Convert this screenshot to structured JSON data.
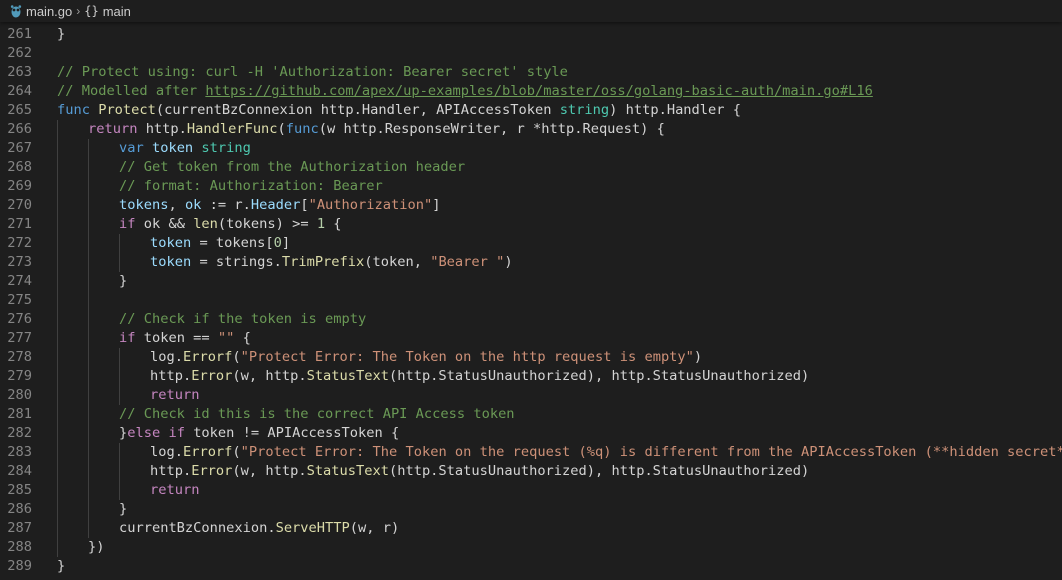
{
  "breadcrumb": {
    "file": "main.go",
    "separator": "›",
    "symbol_icon": "{}",
    "symbol": "main"
  },
  "colors": {
    "background": "#1e1e1e",
    "keyword": "#569cd6",
    "control": "#c586c0",
    "function": "#dcdcaa",
    "variable": "#9cdcfe",
    "string": "#ce9178",
    "comment": "#6a9955",
    "number": "#b5cea8",
    "line_number": "#858585"
  },
  "icons": {
    "file": "go-gopher-icon",
    "symbol": "braces-icon"
  },
  "editor": {
    "lines": [
      {
        "n": "261",
        "indent": 0,
        "tokens": [
          {
            "t": "}",
            "c": "plain"
          }
        ]
      },
      {
        "n": "262",
        "indent": 0,
        "tokens": []
      },
      {
        "n": "263",
        "indent": 0,
        "tokens": [
          {
            "t": "// Protect using: curl -H 'Authorization: Bearer secret' style",
            "c": "com"
          }
        ]
      },
      {
        "n": "264",
        "indent": 0,
        "tokens": [
          {
            "t": "// Modelled after ",
            "c": "com"
          },
          {
            "t": "https://github.com/apex/up-examples/blob/master/oss/golang-basic-auth/main.go#L16",
            "c": "link"
          }
        ]
      },
      {
        "n": "265",
        "indent": 0,
        "tokens": [
          {
            "t": "func ",
            "c": "kw"
          },
          {
            "t": "Protect",
            "c": "fn"
          },
          {
            "t": "(currentBzConnexion http.Handler, APIAccessToken ",
            "c": "plain"
          },
          {
            "t": "string",
            "c": "typ"
          },
          {
            "t": ") http.Handler {",
            "c": "plain"
          }
        ]
      },
      {
        "n": "266",
        "indent": 1,
        "tokens": [
          {
            "t": "return ",
            "c": "ctl"
          },
          {
            "t": "http.",
            "c": "plain"
          },
          {
            "t": "HandlerFunc",
            "c": "fn"
          },
          {
            "t": "(",
            "c": "plain"
          },
          {
            "t": "func",
            "c": "kw"
          },
          {
            "t": "(w http.ResponseWriter, r *http.Request) {",
            "c": "plain"
          }
        ]
      },
      {
        "n": "267",
        "indent": 2,
        "tokens": [
          {
            "t": "var ",
            "c": "kw"
          },
          {
            "t": "token ",
            "c": "var"
          },
          {
            "t": "string",
            "c": "typ"
          }
        ]
      },
      {
        "n": "268",
        "indent": 2,
        "tokens": [
          {
            "t": "// Get token from the Authorization header",
            "c": "com"
          }
        ]
      },
      {
        "n": "269",
        "indent": 2,
        "tokens": [
          {
            "t": "// format: Authorization: Bearer",
            "c": "com"
          }
        ]
      },
      {
        "n": "270",
        "indent": 2,
        "tokens": [
          {
            "t": "tokens",
            "c": "var"
          },
          {
            "t": ", ",
            "c": "plain"
          },
          {
            "t": "ok",
            "c": "var"
          },
          {
            "t": " := r.",
            "c": "plain"
          },
          {
            "t": "Header",
            "c": "var"
          },
          {
            "t": "[",
            "c": "plain"
          },
          {
            "t": "\"Authorization\"",
            "c": "str"
          },
          {
            "t": "]",
            "c": "plain"
          }
        ]
      },
      {
        "n": "271",
        "indent": 2,
        "tokens": [
          {
            "t": "if ",
            "c": "ctl"
          },
          {
            "t": "ok && ",
            "c": "plain"
          },
          {
            "t": "len",
            "c": "fn"
          },
          {
            "t": "(tokens) >= ",
            "c": "plain"
          },
          {
            "t": "1",
            "c": "num"
          },
          {
            "t": " {",
            "c": "plain"
          }
        ]
      },
      {
        "n": "272",
        "indent": 3,
        "tokens": [
          {
            "t": "token",
            "c": "var"
          },
          {
            "t": " = tokens[",
            "c": "plain"
          },
          {
            "t": "0",
            "c": "num"
          },
          {
            "t": "]",
            "c": "plain"
          }
        ]
      },
      {
        "n": "273",
        "indent": 3,
        "tokens": [
          {
            "t": "token",
            "c": "var"
          },
          {
            "t": " = strings.",
            "c": "plain"
          },
          {
            "t": "TrimPrefix",
            "c": "fn"
          },
          {
            "t": "(token, ",
            "c": "plain"
          },
          {
            "t": "\"Bearer \"",
            "c": "str"
          },
          {
            "t": ")",
            "c": "plain"
          }
        ]
      },
      {
        "n": "274",
        "indent": 2,
        "tokens": [
          {
            "t": "}",
            "c": "plain"
          }
        ]
      },
      {
        "n": "275",
        "indent": 2,
        "tokens": []
      },
      {
        "n": "276",
        "indent": 2,
        "tokens": [
          {
            "t": "// Check if the token is empty",
            "c": "com"
          }
        ]
      },
      {
        "n": "277",
        "indent": 2,
        "tokens": [
          {
            "t": "if ",
            "c": "ctl"
          },
          {
            "t": "token == ",
            "c": "plain"
          },
          {
            "t": "\"\"",
            "c": "str"
          },
          {
            "t": " {",
            "c": "plain"
          }
        ]
      },
      {
        "n": "278",
        "indent": 3,
        "tokens": [
          {
            "t": "log.",
            "c": "plain"
          },
          {
            "t": "Errorf",
            "c": "fn"
          },
          {
            "t": "(",
            "c": "plain"
          },
          {
            "t": "\"Protect Error: The Token on the http request is empty\"",
            "c": "str"
          },
          {
            "t": ")",
            "c": "plain"
          }
        ]
      },
      {
        "n": "279",
        "indent": 3,
        "tokens": [
          {
            "t": "http.",
            "c": "plain"
          },
          {
            "t": "Error",
            "c": "fn"
          },
          {
            "t": "(w, http.",
            "c": "plain"
          },
          {
            "t": "StatusText",
            "c": "fn"
          },
          {
            "t": "(http.StatusUnauthorized), http.StatusUnauthorized)",
            "c": "plain"
          }
        ]
      },
      {
        "n": "280",
        "indent": 3,
        "tokens": [
          {
            "t": "return",
            "c": "ctl"
          }
        ]
      },
      {
        "n": "281",
        "indent": 2,
        "tokens": [
          {
            "t": "// Check id this is the correct API Access token",
            "c": "com"
          }
        ]
      },
      {
        "n": "282",
        "indent": 2,
        "tokens": [
          {
            "t": "}",
            "c": "plain"
          },
          {
            "t": "else if ",
            "c": "ctl"
          },
          {
            "t": "token != APIAccessToken {",
            "c": "plain"
          }
        ]
      },
      {
        "n": "283",
        "indent": 3,
        "tokens": [
          {
            "t": "log.",
            "c": "plain"
          },
          {
            "t": "Errorf",
            "c": "fn"
          },
          {
            "t": "(",
            "c": "plain"
          },
          {
            "t": "\"Protect Error: The Token on the request (%q) is different from the APIAccessToken (**hidden secret**) that",
            "c": "str"
          }
        ]
      },
      {
        "n": "284",
        "indent": 3,
        "tokens": [
          {
            "t": "http.",
            "c": "plain"
          },
          {
            "t": "Error",
            "c": "fn"
          },
          {
            "t": "(w, http.",
            "c": "plain"
          },
          {
            "t": "StatusText",
            "c": "fn"
          },
          {
            "t": "(http.StatusUnauthorized), http.StatusUnauthorized)",
            "c": "plain"
          }
        ]
      },
      {
        "n": "285",
        "indent": 3,
        "tokens": [
          {
            "t": "return",
            "c": "ctl"
          }
        ]
      },
      {
        "n": "286",
        "indent": 2,
        "tokens": [
          {
            "t": "}",
            "c": "plain"
          }
        ]
      },
      {
        "n": "287",
        "indent": 2,
        "tokens": [
          {
            "t": "currentBzConnexion.",
            "c": "plain"
          },
          {
            "t": "ServeHTTP",
            "c": "fn"
          },
          {
            "t": "(w, r)",
            "c": "plain"
          }
        ]
      },
      {
        "n": "288",
        "indent": 1,
        "tokens": [
          {
            "t": "})",
            "c": "plain"
          }
        ]
      },
      {
        "n": "289",
        "indent": 0,
        "tokens": [
          {
            "t": "}",
            "c": "plain"
          }
        ]
      }
    ]
  }
}
